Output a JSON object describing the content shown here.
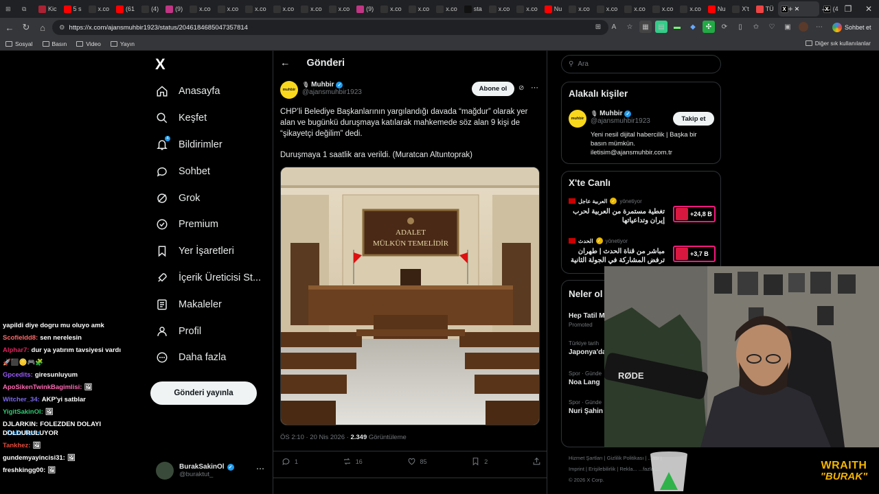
{
  "browser": {
    "tabs": [
      {
        "label": "Kic",
        "color": "#a23"
      },
      {
        "label": "5 s",
        "color": "#f00"
      },
      {
        "label": "x.co",
        "color": "#333"
      },
      {
        "label": "(61",
        "color": "#f00"
      },
      {
        "label": "(4)",
        "color": "#333"
      },
      {
        "label": "(9)",
        "color": "#c13584"
      },
      {
        "label": "x.co",
        "color": "#333"
      },
      {
        "label": "x.co",
        "color": "#333"
      },
      {
        "label": "x.co",
        "color": "#333"
      },
      {
        "label": "x.co",
        "color": "#333"
      },
      {
        "label": "x.co",
        "color": "#333"
      },
      {
        "label": "x.co",
        "color": "#333"
      },
      {
        "label": "(9)",
        "color": "#c13584"
      },
      {
        "label": "x.co",
        "color": "#333"
      },
      {
        "label": "x.co",
        "color": "#333"
      },
      {
        "label": "x.co",
        "color": "#333"
      },
      {
        "label": "sta",
        "color": "#111"
      },
      {
        "label": "x.co",
        "color": "#333"
      },
      {
        "label": "x.co",
        "color": "#333"
      },
      {
        "label": "Nu",
        "color": "#f00"
      },
      {
        "label": "x.co",
        "color": "#333"
      },
      {
        "label": "x.co",
        "color": "#333"
      },
      {
        "label": "x.co",
        "color": "#333"
      },
      {
        "label": "x.co",
        "color": "#333"
      },
      {
        "label": "x.co",
        "color": "#333"
      },
      {
        "label": "Nu",
        "color": "#f00"
      },
      {
        "label": "X't",
        "color": "#333"
      },
      {
        "label": "TÜ",
        "color": "#e44"
      }
    ],
    "active_tab": "x",
    "trailing_tab": "(4",
    "url": "https://x.com/ajansmuhbir1923/status/2046184685047357814",
    "chat_button": "Sohbet et",
    "bookmarks": [
      "Sosyal",
      "Basın",
      "Video",
      "Yayın"
    ],
    "bookmarks_right": "Diğer sık kullanılanlar"
  },
  "nav": {
    "logo": "X",
    "items": [
      {
        "label": "Anasayfa",
        "icon": "home-icon"
      },
      {
        "label": "Keşfet",
        "icon": "search-icon"
      },
      {
        "label": "Bildirimler",
        "icon": "bell-icon",
        "badge": "4"
      },
      {
        "label": "Sohbet",
        "icon": "chat-icon"
      },
      {
        "label": "Grok",
        "icon": "grok-icon"
      },
      {
        "label": "Premium",
        "icon": "premium-icon"
      },
      {
        "label": "Yer İşaretleri",
        "icon": "bookmark-icon"
      },
      {
        "label": "İçerik Üreticisi St...",
        "icon": "rocket-icon"
      },
      {
        "label": "Makaleler",
        "icon": "article-icon"
      },
      {
        "label": "Profil",
        "icon": "profile-icon"
      },
      {
        "label": "Daha fazla",
        "icon": "more-icon"
      }
    ],
    "post_button": "Gönderi yayınla",
    "account": {
      "name": "BurakSakinOl",
      "handle": "@buraktut_"
    }
  },
  "post": {
    "header": "Gönderi",
    "author_name": "Muhbir",
    "author_handle": "@ajansmuhbir1923",
    "avatar_text": "muhbir",
    "subscribe": "Abone ol",
    "text1": "CHP’li Belediye Başkanlarının yargılandığı davada “mağdur” olarak yer alan ve bugünkü duruşmaya katılarak mahkemede söz alan 9 kişi de “şikayetçi değilim” dedi.",
    "text2": "Duruşmaya 1 saatlik ara verildi. (Muratcan Altuntoprak)",
    "image_sign_line1": "ADALET",
    "image_sign_line2": "MÜLKÜN TEMELİDİR",
    "time": "ÖS 2:10 · 20 Nis 2026 · ",
    "views": "2.349",
    "views_label": " Görüntüleme",
    "replies": "1",
    "reposts": "16",
    "likes": "85",
    "bookmarks": "2"
  },
  "right": {
    "search_placeholder": "Ara",
    "related_title": "Alakalı kişiler",
    "related_name": "Muhbir",
    "related_handle": "@ajansmuhbir1923",
    "follow": "Takip et",
    "bio": "Yeni nesil dijital habercilik | Başka bir basın mümkün. iletisim@ajansmuhbir.com.tr",
    "live_title": "X'te Canlı",
    "live": [
      {
        "source": "العربية عاجل",
        "host": "yönetiyor",
        "title": "تغطية مستمرة من العربية لحرب إيران وتداعياتها",
        "count": "+24,8 B"
      },
      {
        "source": "الحدث",
        "host": "yönetiyor",
        "title": "مباشر من قناة الحدث | طهران ترفض المشاركة في الجولة الثانية من",
        "count": "+3,7 B"
      }
    ],
    "happening_title": "Neler ol",
    "trends": [
      {
        "ctx": "",
        "title": "Hep Tatil M",
        "promo": "Promoted"
      },
      {
        "ctx": "Türkiye tarih",
        "title": "Japonya'da"
      },
      {
        "ctx": "Spor · Günde",
        "title": "Noa Lang"
      },
      {
        "ctx": "Spor · Günde",
        "title": "Nuri Şahin"
      }
    ],
    "show_more": "Daha fazla",
    "footer_line1": "Hizmet Şartları  |  Gizlilik Politikası  |  ...ası  |",
    "footer_line2": "Imprint  |  Erişilebilirlik  |  Rekla...  ...fazla ...",
    "footer_line3": "© 2026 X Corp."
  },
  "chat": [
    {
      "user": "",
      "color": "#ffffff",
      "text": "yapildi diye dogru mu oluyo amk"
    },
    {
      "user": "Scofieldd8:",
      "color": "#ff6b6b",
      "text": "sen nerelesin"
    },
    {
      "user": "Alphar7:",
      "color": "#e0245e",
      "text": "dur ya yatırım tavsiyesi vardı"
    },
    {
      "user": "",
      "color": "#ffffff",
      "text": "🚀⬛🪙🎮🧩"
    },
    {
      "user": "Gpcedits:",
      "color": "#9b59ff",
      "text": "giresunluyum"
    },
    {
      "user": "ApoSikenTwinkBagimlisi:",
      "color": "#ff69b4",
      "text": "🖼"
    },
    {
      "user": "Witcher_34:",
      "color": "#7b68ee",
      "text": "AKP'yi satblar"
    },
    {
      "user": "YigitSakinOl:",
      "color": "#2ecc71",
      "text": "🖼"
    },
    {
      "user": "DJLARKIN:",
      "color": "#ffffff",
      "text": "FOLEZDEN DOLAYI DOLDURULUYOR"
    },
    {
      "user": "Tankhez:",
      "color": "#e74c3c",
      "text": "🖼"
    },
    {
      "user": "gundemyayincisi31:",
      "color": "#ffffff",
      "text": "🖼"
    },
    {
      "user": "freshkingg00:",
      "color": "#ffffff",
      "text": "🖼"
    }
  ],
  "overlay": {
    "brand_line1": "WRAITH",
    "brand_line2": "\"BURAK\"",
    "mic_label": "RØDE"
  }
}
